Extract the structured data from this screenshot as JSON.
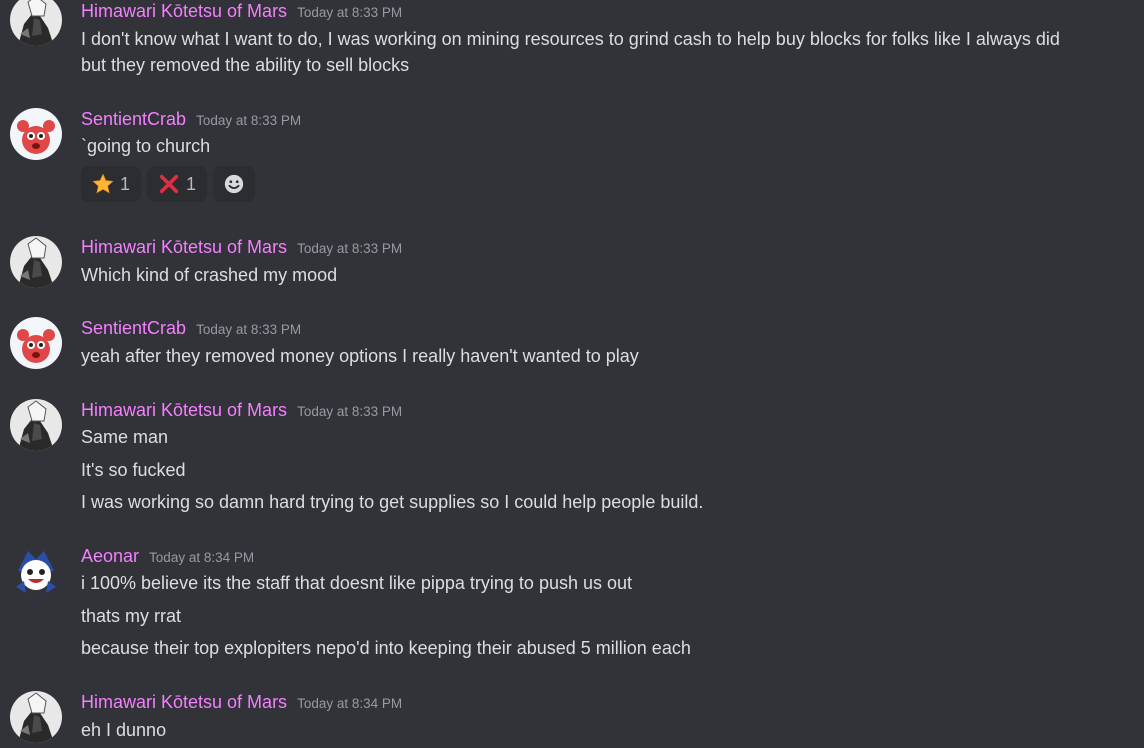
{
  "messages": [
    {
      "author": "Himawari Kōtetsu of Mars",
      "timestamp": "Today at 8:33 PM",
      "lines": [
        "I don't know what I want to do, I was working on mining resources to grind cash to help buy blocks for folks like I always did",
        "but they removed the ability to sell blocks"
      ]
    },
    {
      "author": "SentientCrab",
      "timestamp": "Today at 8:33 PM",
      "lines": [
        "`going to church"
      ],
      "reactions": [
        {
          "emoji": "star-icon",
          "count": "1"
        },
        {
          "emoji": "cross-mark-icon",
          "count": "1"
        }
      ],
      "add_reaction_icon": "smiley-add-reaction-icon"
    },
    {
      "author": "Himawari Kōtetsu of Mars",
      "timestamp": "Today at 8:33 PM",
      "lines": [
        "Which kind of crashed my mood"
      ]
    },
    {
      "author": "SentientCrab",
      "timestamp": "Today at 8:33 PM",
      "lines": [
        "yeah after they removed money options I really haven't wanted to play"
      ]
    },
    {
      "author": "Himawari Kōtetsu of Mars",
      "timestamp": "Today at 8:33 PM",
      "lines": [
        "Same man",
        "It's so fucked",
        "I was working so damn hard trying to get supplies so I could help people build."
      ]
    },
    {
      "author": "Aeonar",
      "timestamp": "Today at 8:34 PM",
      "lines": [
        "i 100% believe its the staff that doesnt like pippa trying to push us out",
        "thats my rrat",
        "because their top explopiters nepo'd into keeping their abused 5 million each"
      ]
    },
    {
      "author": "Himawari Kōtetsu of Mars",
      "timestamp": "Today at 8:34 PM",
      "lines": [
        "eh I dunno"
      ]
    }
  ],
  "colors": {
    "background": "#313338",
    "username": "#f47fff",
    "timestamp": "#949ba4",
    "text": "#dbdee1",
    "reaction_bg": "#2b2d31"
  }
}
